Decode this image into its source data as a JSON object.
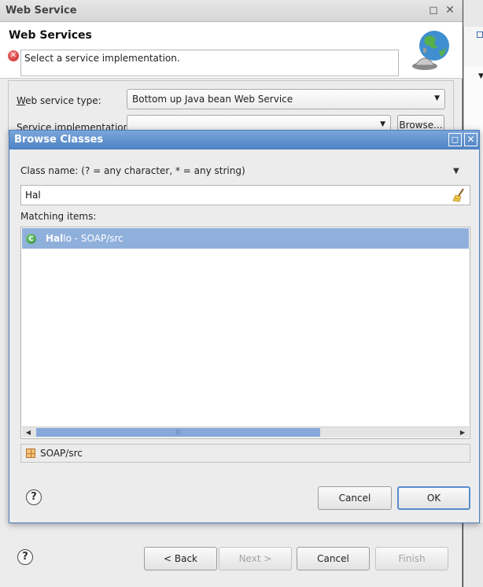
{
  "web_service_window": {
    "title": "Web Service",
    "heading": "Web Services",
    "message": "Select a service implementation.",
    "service_type_label_prefix": "W",
    "service_type_label_rest": "eb service type:",
    "service_type_value": "Bottom up Java bean Web Service",
    "service_impl_label": "Service implementation:",
    "service_impl_value": "",
    "browse_button": "Browse...",
    "buttons": {
      "back": "< Back",
      "next": "Next >",
      "cancel": "Cancel",
      "finish": "Finish"
    },
    "help": "?"
  },
  "browse_dialog": {
    "title": "Browse Classes",
    "class_name_label": "Class name: (? = any character, * = any string)",
    "class_name_value": "Hal",
    "matching_label": "Matching items:",
    "items": [
      {
        "match": "Hal",
        "rest": "lo - SOAP/src",
        "icon": "class-icon",
        "selected": true
      }
    ],
    "status": "SOAP/src",
    "cancel_button": "Cancel",
    "ok_button": "OK",
    "help": "?"
  },
  "colors": {
    "dialog_title_bar": "#4e82c4",
    "selection": "#90b0dc",
    "scroll_thumb": "#86a8db",
    "error": "#c81e1e"
  }
}
